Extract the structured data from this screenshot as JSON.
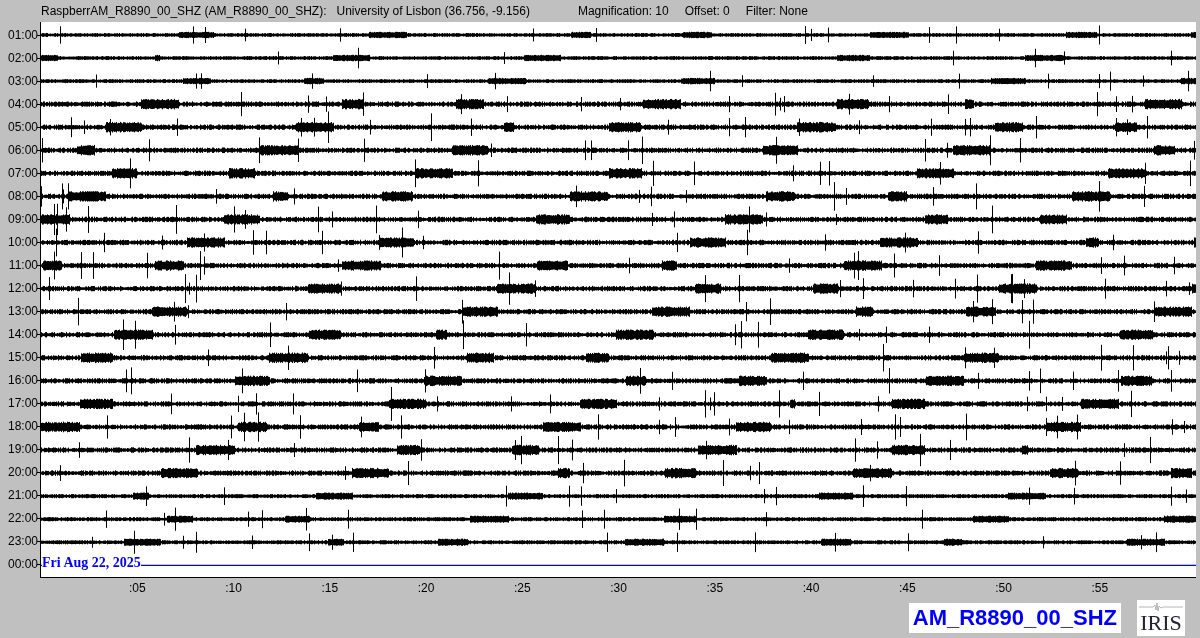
{
  "header": {
    "station": "RaspberrAM_R8890_00_SHZ (AM_R8890_00_SHZ):",
    "location": "University of Lisbon (36.756, -9.156)",
    "magnification": "Magnification: 10",
    "offset": "Offset: 0",
    "filter": "Filter: None"
  },
  "rows": [
    {
      "label": "01:00",
      "kind": "trace"
    },
    {
      "label": "02:00",
      "kind": "trace"
    },
    {
      "label": "03:00",
      "kind": "trace"
    },
    {
      "label": "04:00",
      "kind": "trace"
    },
    {
      "label": "05:00",
      "kind": "trace"
    },
    {
      "label": "06:00",
      "kind": "trace"
    },
    {
      "label": "07:00",
      "kind": "trace"
    },
    {
      "label": "08:00",
      "kind": "trace"
    },
    {
      "label": "09:00",
      "kind": "trace"
    },
    {
      "label": "10:00",
      "kind": "trace"
    },
    {
      "label": "11:00",
      "kind": "trace"
    },
    {
      "label": "12:00",
      "kind": "trace"
    },
    {
      "label": "13:00",
      "kind": "trace"
    },
    {
      "label": "14:00",
      "kind": "trace"
    },
    {
      "label": "15:00",
      "kind": "trace"
    },
    {
      "label": "16:00",
      "kind": "trace"
    },
    {
      "label": "17:00",
      "kind": "trace"
    },
    {
      "label": "18:00",
      "kind": "trace"
    },
    {
      "label": "19:00",
      "kind": "trace"
    },
    {
      "label": "20:00",
      "kind": "trace"
    },
    {
      "label": "21:00",
      "kind": "trace"
    },
    {
      "label": "22:00",
      "kind": "trace"
    },
    {
      "label": "23:00",
      "kind": "trace"
    },
    {
      "label": "00:00",
      "kind": "day-line"
    }
  ],
  "date": "Fri Aug 22, 2025",
  "x_ticks": [
    ":05",
    ":10",
    ":15",
    ":20",
    ":25",
    ":30",
    ":35",
    ":40",
    ":45",
    ":50",
    ":55"
  ],
  "channel_label": "AM_R8890_00_SHZ",
  "logo": "IRIS"
}
